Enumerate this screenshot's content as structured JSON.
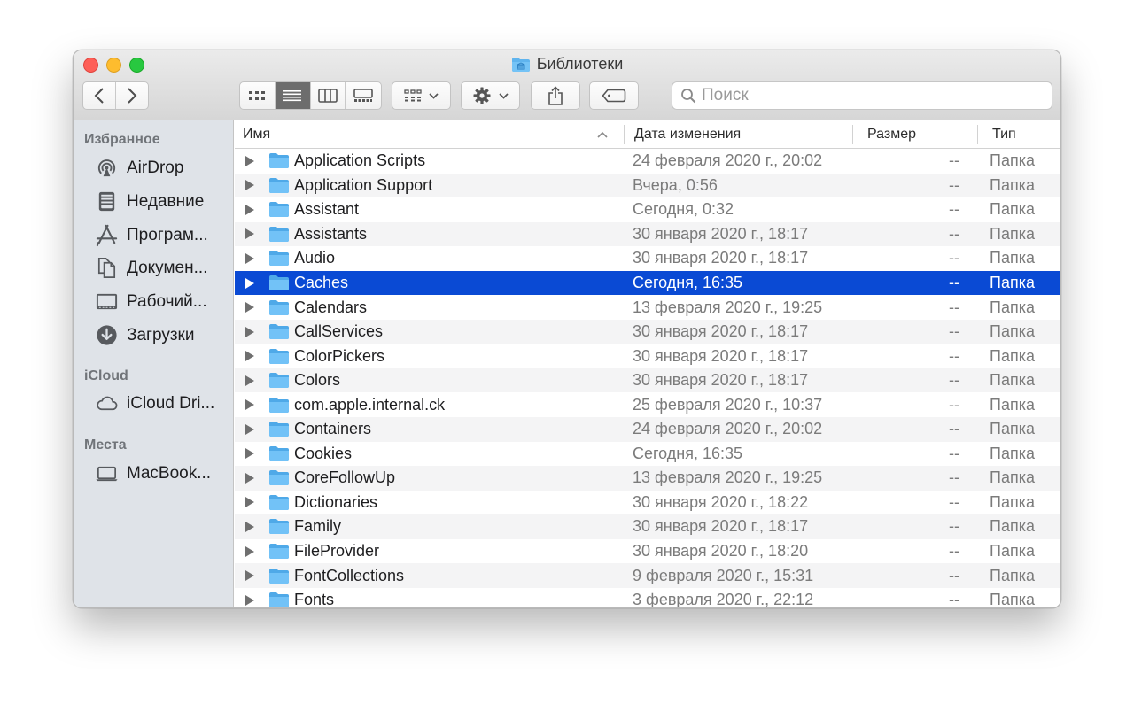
{
  "window": {
    "title": "Библиотеки",
    "title_icon": "library-folder-icon"
  },
  "toolbar": {
    "back_icon": "chevron-left-icon",
    "forward_icon": "chevron-right-icon",
    "view_modes": [
      "icon-view-icon",
      "list-view-icon",
      "column-view-icon",
      "gallery-view-icon"
    ],
    "active_view": "list-view-icon",
    "group_icon": "group-by-icon",
    "action_icon": "gear-icon",
    "share_icon": "share-icon",
    "tag_icon": "tag-icon",
    "search_placeholder": "Поиск"
  },
  "sidebar": {
    "favorites_label": "Избранное",
    "favorites": [
      {
        "label": "AirDrop",
        "icon": "airdrop-icon"
      },
      {
        "label": "Недавние",
        "icon": "recents-icon"
      },
      {
        "label": "Програм...",
        "icon": "applications-icon"
      },
      {
        "label": "Докумен...",
        "icon": "documents-icon"
      },
      {
        "label": "Рабочий...",
        "icon": "desktop-icon"
      },
      {
        "label": "Загрузки",
        "icon": "downloads-icon"
      }
    ],
    "icloud_label": "iCloud",
    "icloud": [
      {
        "label": "iCloud Dri...",
        "icon": "icloud-icon"
      }
    ],
    "places_label": "Места",
    "places": [
      {
        "label": "MacBook...",
        "icon": "laptop-icon"
      }
    ]
  },
  "columns": {
    "name": "Имя",
    "date": "Дата изменения",
    "size": "Размер",
    "kind": "Тип"
  },
  "rows": [
    {
      "name": "Application Scripts",
      "date": "24 февраля 2020 г., 20:02",
      "size": "--",
      "kind": "Папка"
    },
    {
      "name": "Application Support",
      "date": "Вчера, 0:56",
      "size": "--",
      "kind": "Папка"
    },
    {
      "name": "Assistant",
      "date": "Сегодня, 0:32",
      "size": "--",
      "kind": "Папка"
    },
    {
      "name": "Assistants",
      "date": "30 января 2020 г., 18:17",
      "size": "--",
      "kind": "Папка"
    },
    {
      "name": "Audio",
      "date": "30 января 2020 г., 18:17",
      "size": "--",
      "kind": "Папка"
    },
    {
      "name": "Caches",
      "date": "Сегодня, 16:35",
      "size": "--",
      "kind": "Папка",
      "selected": true
    },
    {
      "name": "Calendars",
      "date": "13 февраля 2020 г., 19:25",
      "size": "--",
      "kind": "Папка"
    },
    {
      "name": "CallServices",
      "date": "30 января 2020 г., 18:17",
      "size": "--",
      "kind": "Папка"
    },
    {
      "name": "ColorPickers",
      "date": "30 января 2020 г., 18:17",
      "size": "--",
      "kind": "Папка"
    },
    {
      "name": "Colors",
      "date": "30 января 2020 г., 18:17",
      "size": "--",
      "kind": "Папка"
    },
    {
      "name": "com.apple.internal.ck",
      "date": "25 февраля 2020 г., 10:37",
      "size": "--",
      "kind": "Папка"
    },
    {
      "name": "Containers",
      "date": "24 февраля 2020 г., 20:02",
      "size": "--",
      "kind": "Папка"
    },
    {
      "name": "Cookies",
      "date": "Сегодня, 16:35",
      "size": "--",
      "kind": "Папка"
    },
    {
      "name": "CoreFollowUp",
      "date": "13 февраля 2020 г., 19:25",
      "size": "--",
      "kind": "Папка"
    },
    {
      "name": "Dictionaries",
      "date": "30 января 2020 г., 18:22",
      "size": "--",
      "kind": "Папка"
    },
    {
      "name": "Family",
      "date": "30 января 2020 г., 18:17",
      "size": "--",
      "kind": "Папка"
    },
    {
      "name": "FileProvider",
      "date": "30 января 2020 г., 18:20",
      "size": "--",
      "kind": "Папка"
    },
    {
      "name": "FontCollections",
      "date": "9 февраля 2020 г., 15:31",
      "size": "--",
      "kind": "Папка"
    },
    {
      "name": "Fonts",
      "date": "3 февраля 2020 г., 22:12",
      "size": "--",
      "kind": "Папка"
    }
  ],
  "colors": {
    "selection": "#0a4ad4",
    "folder": "#6cc0f5",
    "sidebar_bg": "#dfe3e8"
  }
}
